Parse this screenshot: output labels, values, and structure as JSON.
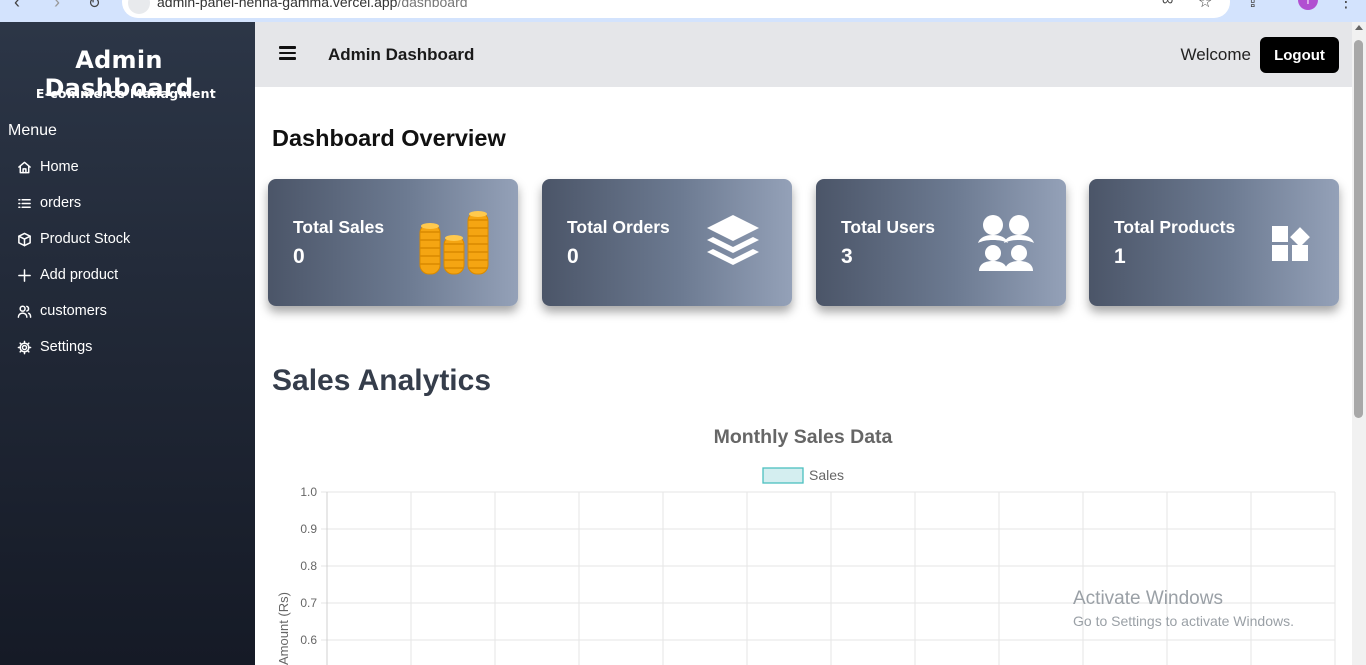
{
  "browser": {
    "url_host": "admin-panel-henna-gamma.vercel.app",
    "url_path": "/dashboard",
    "profile_initial": "T"
  },
  "sidebar": {
    "brand": "Admin Dashboard",
    "brand_sub": "E-commerce Managment",
    "menu_title": "Menue",
    "items": [
      {
        "label": "Home",
        "icon": "home-icon"
      },
      {
        "label": "orders",
        "icon": "list-icon"
      },
      {
        "label": "Product Stock",
        "icon": "box-icon"
      },
      {
        "label": "Add product",
        "icon": "plus-icon"
      },
      {
        "label": "customers",
        "icon": "users-icon"
      },
      {
        "label": "Settings",
        "icon": "gear-icon"
      }
    ]
  },
  "topbar": {
    "title": "Admin Dashboard",
    "welcome": "Welcome",
    "logout_label": "Logout"
  },
  "overview": {
    "title": "Dashboard Overview",
    "cards": [
      {
        "label": "Total Sales",
        "value": "0",
        "icon": "coins-icon"
      },
      {
        "label": "Total Orders",
        "value": "0",
        "icon": "layers-icon"
      },
      {
        "label": "Total Users",
        "value": "3",
        "icon": "users-group-icon"
      },
      {
        "label": "Total Products",
        "value": "1",
        "icon": "shapes-icon"
      }
    ]
  },
  "analytics": {
    "title": "Sales Analytics"
  },
  "chart_data": {
    "type": "bar",
    "title": "Monthly Sales Data",
    "series": [
      {
        "name": "Sales",
        "values": []
      }
    ],
    "ylabel": "Amount (Rs)",
    "y_ticks": [
      "1.0",
      "0.9",
      "0.8",
      "0.7",
      "0.6"
    ],
    "ylim": [
      0,
      1
    ],
    "grid": true,
    "legend": "top",
    "legend_fill": "#d4eef0",
    "legend_stroke": "#4bc0c0"
  },
  "os_overlay": {
    "line1": "Activate Windows",
    "line2": "Go to Settings to activate Windows."
  },
  "colors": {
    "sidebar_bg": "#1f2634",
    "card_gradient_start": "#4b5568",
    "card_gradient_end": "#94a1b8",
    "coin": "#f5a512"
  }
}
